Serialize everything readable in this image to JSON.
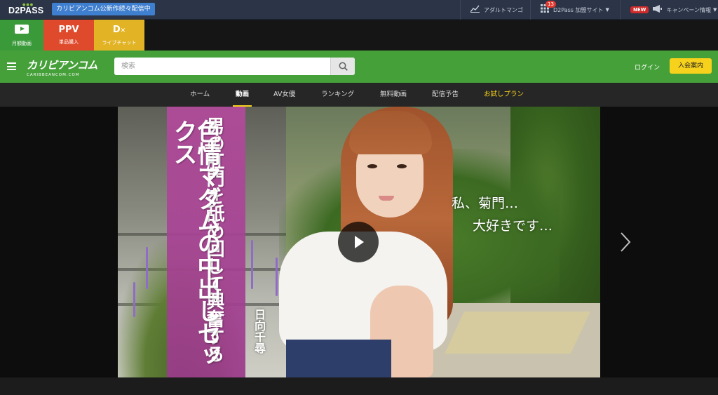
{
  "topbar": {
    "logo": "D2PASS",
    "notice": "カリビアンコム公新作続々配信中",
    "items": [
      {
        "label": "アダルトマンゴ",
        "icon": "chart-icon"
      },
      {
        "label": "D2Pass 加盟サイト",
        "icon": "grid-icon",
        "badge": "13"
      },
      {
        "label": "キャンペーン情報",
        "icon": "megaphone-icon",
        "tag": "NEW"
      }
    ]
  },
  "tiles": [
    {
      "title": "",
      "label": "月額動画",
      "color": "#3a9a3a"
    },
    {
      "title": "PPV",
      "label": "単品購入",
      "color": "#e04a2c"
    },
    {
      "title": "D",
      "label": "ライブチャット",
      "color": "#e2b324"
    }
  ],
  "header": {
    "brand_main": "カリビアンコム",
    "brand_sub": "CARIBBEANCOM.COM",
    "search_placeholder": "検索",
    "login": "ログイン",
    "join": "入会案内"
  },
  "tabs": [
    {
      "label": "ホーム"
    },
    {
      "label": "動画"
    },
    {
      "label": "AV女優"
    },
    {
      "label": "ランキング"
    },
    {
      "label": "無料動画"
    },
    {
      "label": "配信予告"
    },
    {
      "label": "お試しプラン"
    }
  ],
  "hero": {
    "line1": "男の肛門を舐め回して興奮する",
    "line2": "色情マダムの中出しセックス",
    "name": "日向千尋",
    "side_line1": "私、菊門…",
    "side_line2": "大好きです…"
  }
}
